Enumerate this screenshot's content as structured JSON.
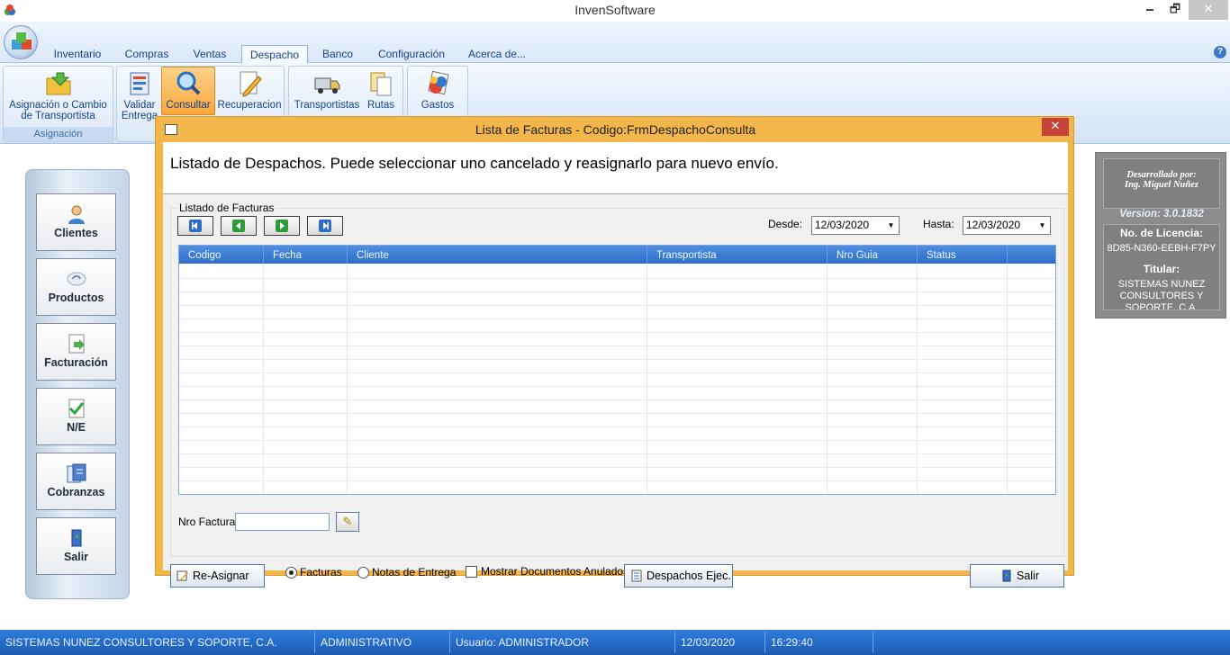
{
  "window": {
    "title": "InvenSoftware",
    "min": "🗕",
    "max": "🗗",
    "close": "✕"
  },
  "ribbon": {
    "tabs": [
      "Inventario",
      "Compras",
      "Ventas",
      "Despacho",
      "Banco",
      "Configuración",
      "Acerca de..."
    ],
    "active_tab": "Despacho",
    "groups": {
      "asignacion": {
        "label": "Asignación",
        "button": {
          "label_line1": "Asignación o Cambio",
          "label_line2": "de Transportista",
          "icon": "folder-arrow-icon"
        }
      },
      "despacho_buttons": [
        {
          "label_line1": "Validar",
          "label_line2": "Entrega",
          "icon": "validate-icon"
        },
        {
          "label_line1": "Consultar",
          "label_line2": "",
          "icon": "magnifier-icon",
          "active": true
        },
        {
          "label_line1": "Recuperacion",
          "label_line2": "",
          "icon": "pencil-icon"
        }
      ],
      "transport_buttons": [
        {
          "label_line1": "Transportistas",
          "label_line2": "",
          "icon": "truck-icon"
        },
        {
          "label_line1": "Rutas",
          "label_line2": "",
          "icon": "documents-icon"
        }
      ],
      "gastos_button": {
        "label_line1": "Gastos",
        "label_line2": "",
        "icon": "expenses-icon"
      }
    }
  },
  "sidebar": {
    "items": [
      {
        "label": "Clientes",
        "icon": "user-icon"
      },
      {
        "label": "Productos",
        "icon": "product-icon"
      },
      {
        "label": "Facturación",
        "icon": "invoice-icon"
      },
      {
        "label": "N/E",
        "icon": "checkmark-icon"
      },
      {
        "label": "Cobranzas",
        "icon": "collections-icon"
      },
      {
        "label": "Salir",
        "icon": "exit-door-icon"
      }
    ]
  },
  "info": {
    "dev_line1": "Desarrollado por:",
    "dev_line2": "Ing. Miguel Nuñez",
    "version": "Version: 3.0.1832",
    "license_title": "No. de Licencia:",
    "license_value": "8D85-N360-EEBH-F7PY",
    "holder_title": "Titular:",
    "holder_value": "SISTEMAS NUNEZ CONSULTORES Y SOPORTE, C.A."
  },
  "dialog": {
    "title": "Lista de Facturas - Codigo:FrmDespachoConsulta",
    "close": "✕",
    "header": "Listado de Despachos. Puede seleccionar uno cancelado y reasignarlo para nuevo envío.",
    "group_title": "Listado de Facturas",
    "desde_label": "Desde:",
    "desde_value": "12/03/2020",
    "hasta_label": "Hasta:",
    "hasta_value": "12/03/2020",
    "dropdown_arrow": "▼",
    "columns": [
      "Codigo",
      "Fecha",
      "Cliente",
      "Transportista",
      "Nro Guia",
      "Status"
    ],
    "nro_factura_label": "Nro Factura:",
    "nro_factura_value": "",
    "reasignar_label": "Re-Asignar",
    "radio_facturas": "Facturas",
    "radio_notas": "Notas de Entrega",
    "radio_selected": "Facturas",
    "check_anulados": "Mostrar Documentos Anulados",
    "despachos_label": "Despachos Ejec.",
    "salir_label": "Salir"
  },
  "statusbar": {
    "company": "SISTEMAS NUNEZ CONSULTORES Y SOPORTE, C.A.",
    "role": "ADMINISTRATIVO",
    "user": "Usuario: ADMINISTRADOR",
    "date": "12/03/2020",
    "time": "16:29:40"
  }
}
